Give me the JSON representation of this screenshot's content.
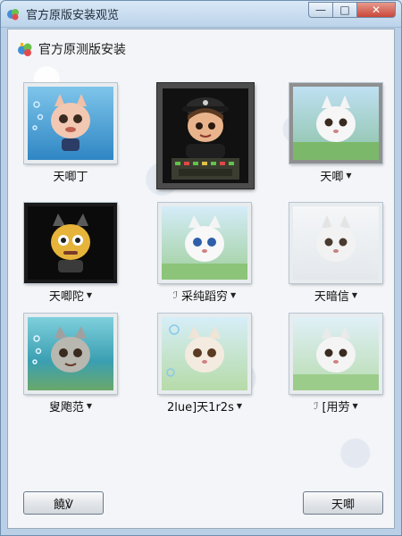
{
  "window": {
    "title": "官方原版安装观览",
    "controls": {
      "minimize": "—",
      "maximize": "□",
      "close": "✕"
    }
  },
  "header": {
    "text": "官方原测版安装"
  },
  "tiles": [
    {
      "label": "天唧丁",
      "dropdown": false,
      "prefix": ""
    },
    {
      "label": "",
      "dropdown": false,
      "prefix": ""
    },
    {
      "label": "天唧",
      "dropdown": true,
      "prefix": ""
    },
    {
      "label": "天唧陀",
      "dropdown": true,
      "prefix": ""
    },
    {
      "label": "采纯蹈穷",
      "dropdown": true,
      "prefix": "ℐ"
    },
    {
      "label": "天暗信",
      "dropdown": true,
      "prefix": ""
    },
    {
      "label": "叟飑范",
      "dropdown": true,
      "prefix": ""
    },
    {
      "label": "2lue]天1r2s",
      "dropdown": true,
      "prefix": ""
    },
    {
      "label": "[用劳",
      "dropdown": true,
      "prefix": "ℐ"
    }
  ],
  "buttons": {
    "left": "饒℣",
    "right": "天唧"
  },
  "colors": {
    "accent": "#b9d0e6",
    "close": "#c8473a"
  }
}
